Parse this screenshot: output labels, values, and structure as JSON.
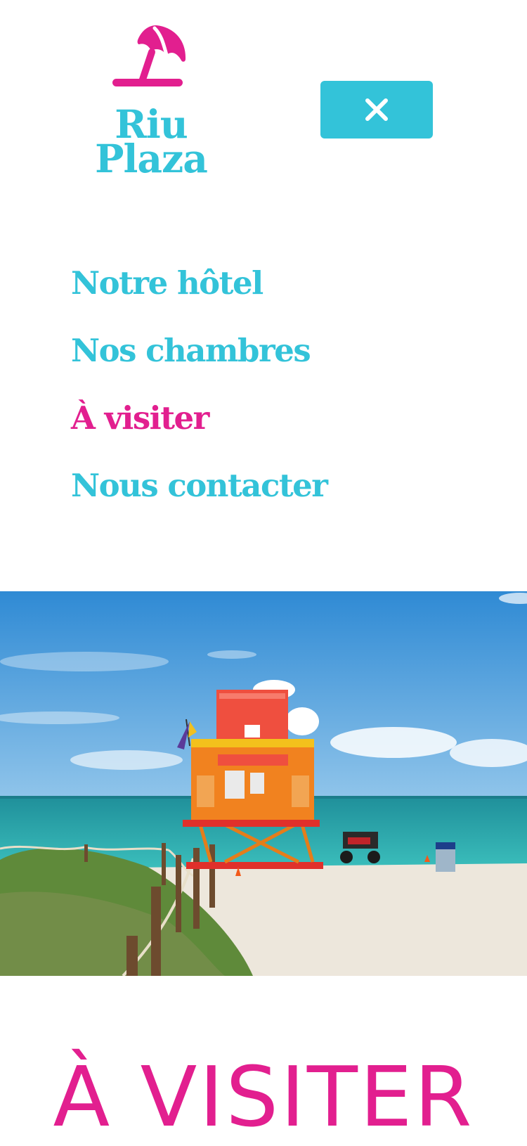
{
  "header": {
    "logo": {
      "icon": "beach-umbrella-icon",
      "line1": "Riu",
      "line2": "Plaza"
    },
    "close_button": {
      "icon": "close-icon"
    }
  },
  "menu": {
    "items": [
      {
        "label": "Notre hôtel",
        "active": false
      },
      {
        "label": "Nos chambres",
        "active": false
      },
      {
        "label": "À visiter",
        "active": true
      },
      {
        "label": "Nous contacter",
        "active": false
      }
    ]
  },
  "hero": {
    "subject": "beach-lifeguard-tower-photo"
  },
  "page": {
    "title": "À VISITER"
  },
  "colors": {
    "primary": "#33c3d9",
    "accent": "#e21f8f",
    "background": "#ffffff"
  }
}
